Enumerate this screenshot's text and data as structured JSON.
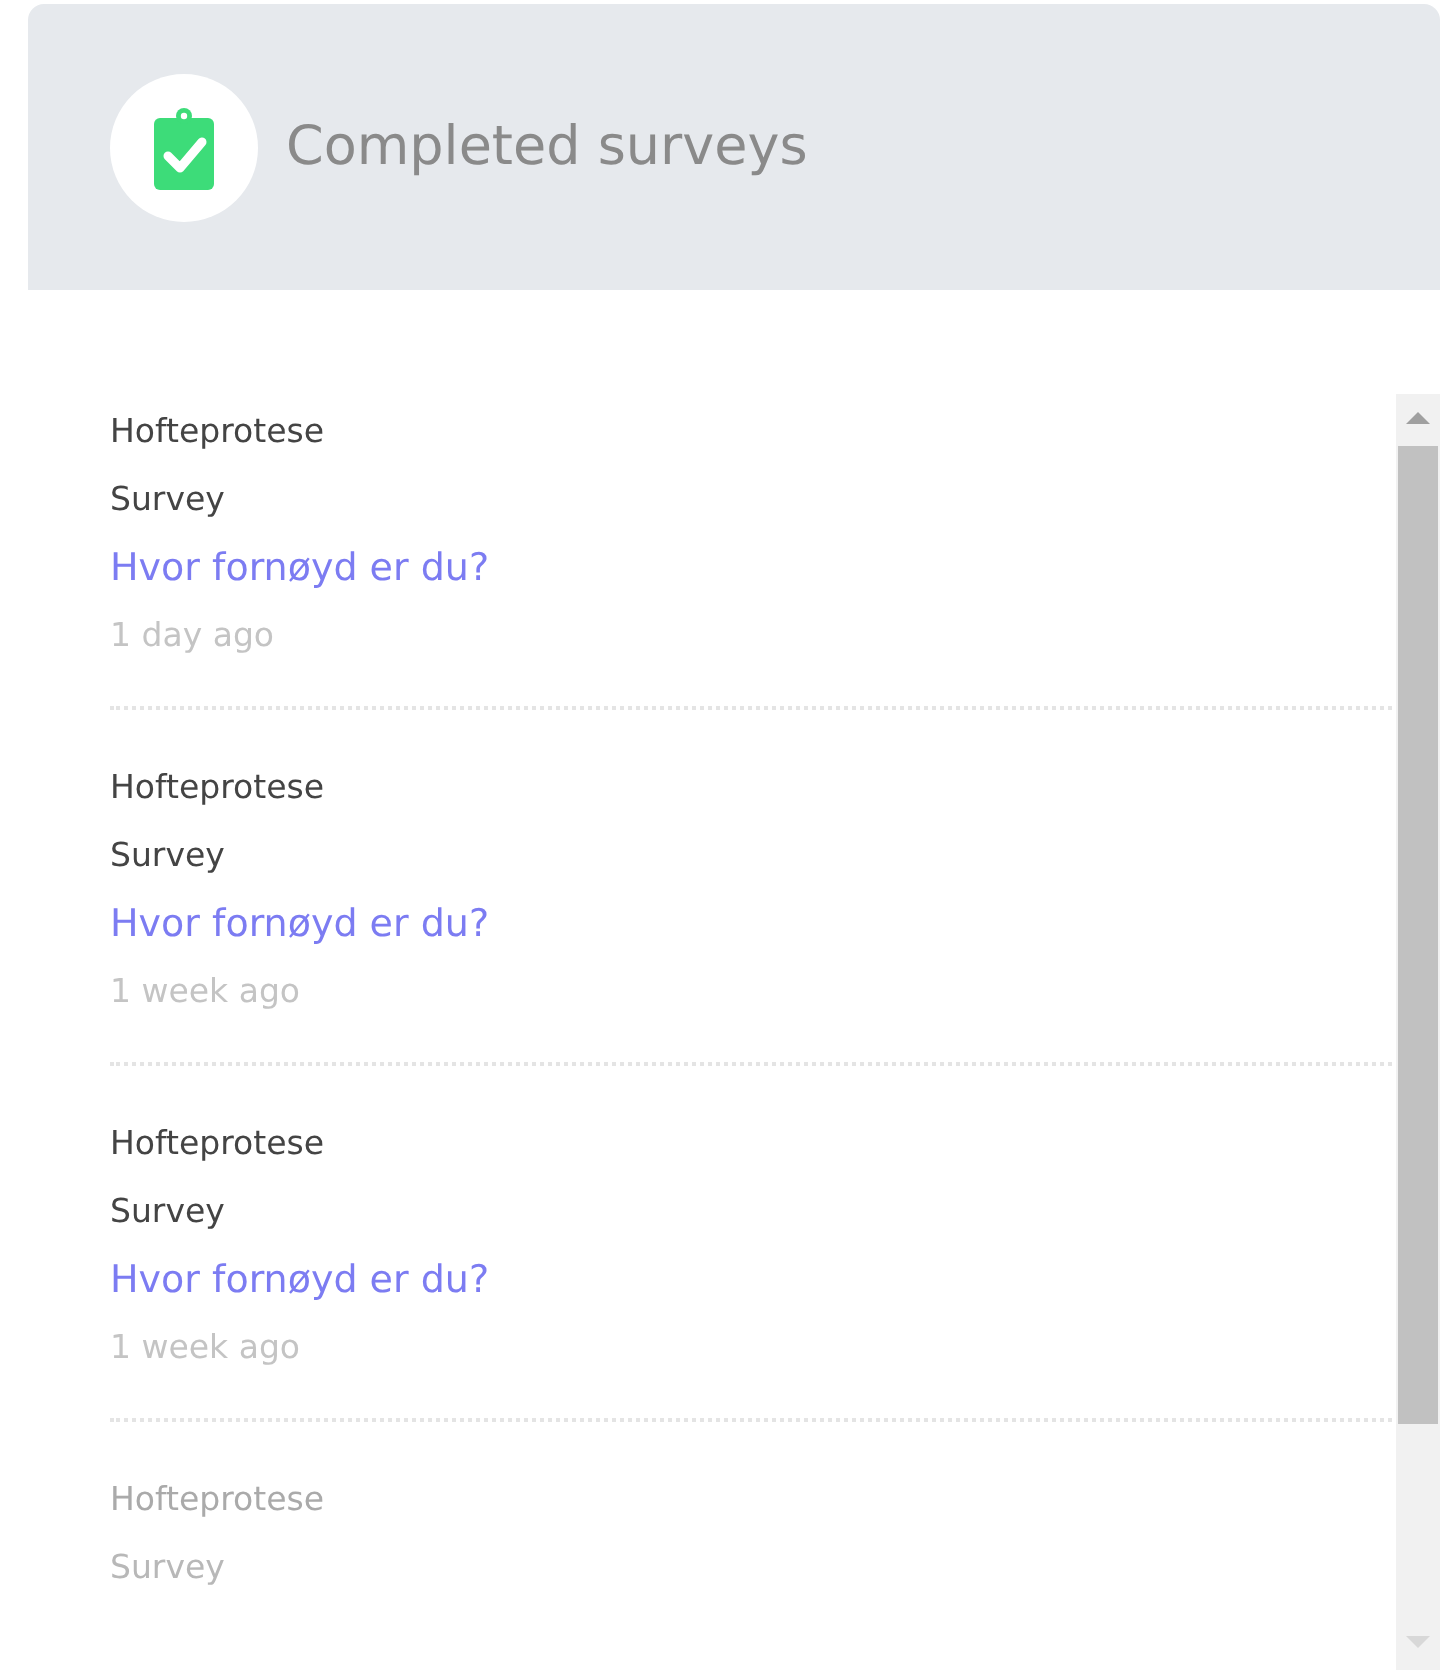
{
  "header": {
    "title": "Completed surveys"
  },
  "surveys": [
    {
      "category": "Hofteprotese",
      "type": "Survey",
      "title": "Hvor fornøyd er du?",
      "time": "1 day ago"
    },
    {
      "category": "Hofteprotese",
      "type": "Survey",
      "title": "Hvor fornøyd er du?",
      "time": "1 week ago"
    },
    {
      "category": "Hofteprotese",
      "type": "Survey",
      "title": "Hvor fornøyd er du?",
      "time": "1 week ago"
    },
    {
      "category": "Hofteprotese",
      "type": "Survey"
    }
  ]
}
